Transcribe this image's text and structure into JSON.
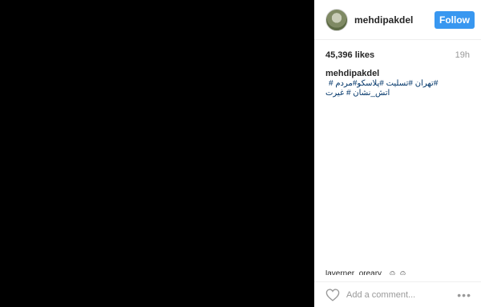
{
  "post": {
    "media": {
      "background": "#000000"
    },
    "header": {
      "avatar_icon": "user-avatar",
      "username": "mehdipakdel",
      "follow_label": "Follow",
      "follow_color": "#3897f0"
    },
    "likes": "45,396 likes",
    "time": "19h",
    "caption": {
      "username": "mehdipakdel",
      "line1": "# تهران #تسلیت #پلاسکو#مردم#",
      "line2": "آتش_نشان # غیرت",
      "link_color": "#003569"
    },
    "partial_comment": "laverner_oreary_ ☺ ☺",
    "footer": {
      "like_icon": "heart-outline",
      "comment_placeholder": "Add a comment...",
      "more_icon": "ellipsis",
      "more_label": "•••"
    }
  }
}
